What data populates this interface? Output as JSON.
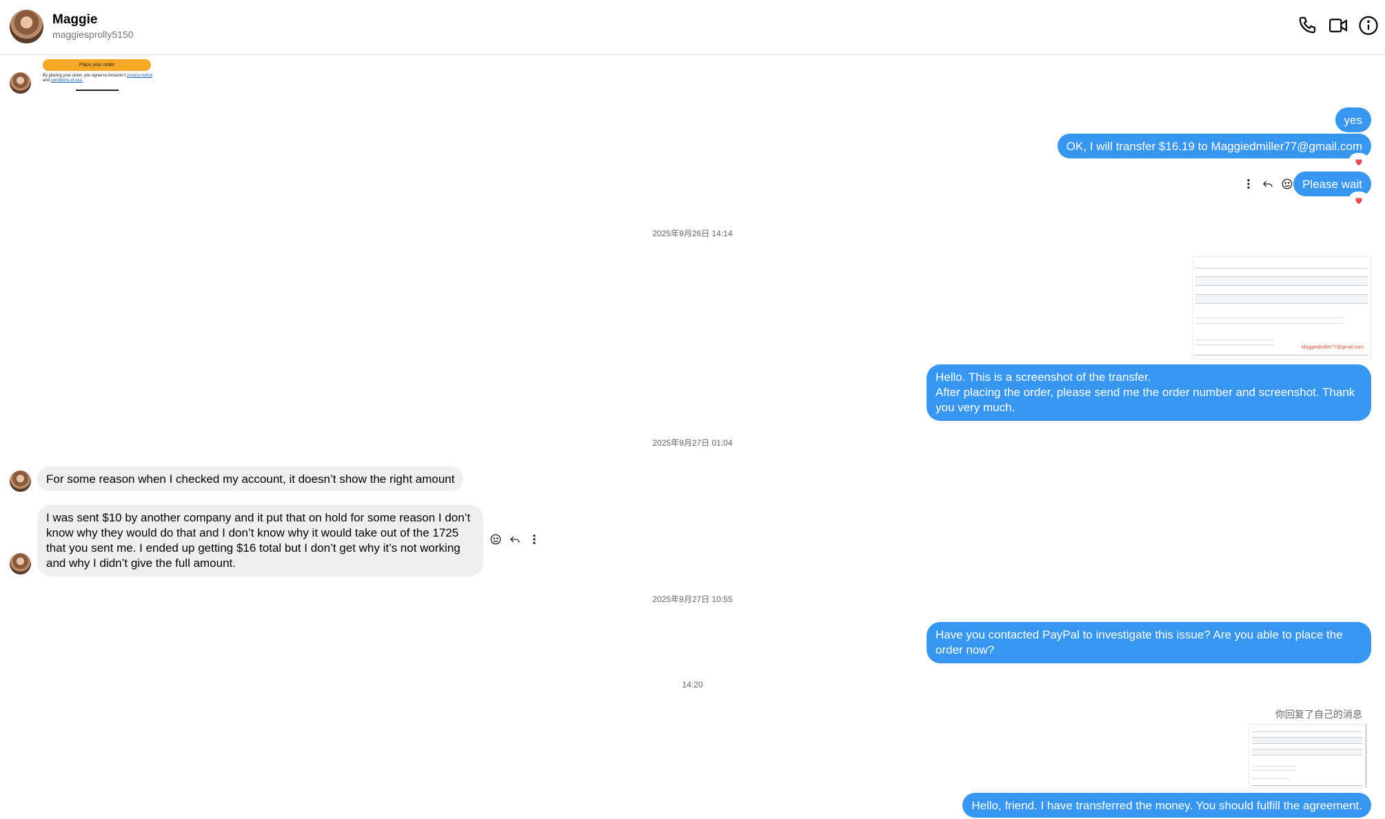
{
  "header": {
    "name": "Maggie",
    "handle": "maggiesprolly5150",
    "icons": [
      "phone-icon",
      "video-camera-icon",
      "info-icon"
    ]
  },
  "colors": {
    "outgoing_bubble": "#3797f0",
    "incoming_bubble": "#efefef",
    "heart": "#ed4956"
  },
  "amazon_preview": {
    "button_label": "Place your order",
    "legal_prefix": "By placing your order, you agree to Amazon's ",
    "privacy_link": "privacy notice",
    "and_text": "and ",
    "conditions_link": "conditions of use."
  },
  "messages": {
    "m1": "yes",
    "m2": "OK, I will transfer $16.19 to Maggiedmiller77@gmail.com",
    "m3": "Please wait",
    "ts1": "2025年9月26日 14:14",
    "transfer_email": "Maggiedmiller77@gmail.com",
    "m4_line1": "Hello. This is a screenshot of the transfer.",
    "m4_line2": "After placing the order, please send me the order number and screenshot. Thank you very much.",
    "ts2": "2025年9月27日 01:04",
    "m5": "For some reason when I checked my account, it doesn’t show the right amount",
    "m6": "I was sent $10 by another company and it put that on hold for some reason I don’t know why they would do that and I don’t know why it would take out of the 1725 that you sent me. I ended up getting $16 total but I don’t get why it’s not working and why I didn’t give the full amount.",
    "ts3": "2025年9月27日 10:55",
    "m7": "Have you contacted PayPal to investigate this issue? Are you able to place the order now?",
    "ts4": "14:20",
    "replied_note": "你回复了自己的消息",
    "m8": "Hello, friend. I have transferred the money. You should fulfill the agreement."
  }
}
